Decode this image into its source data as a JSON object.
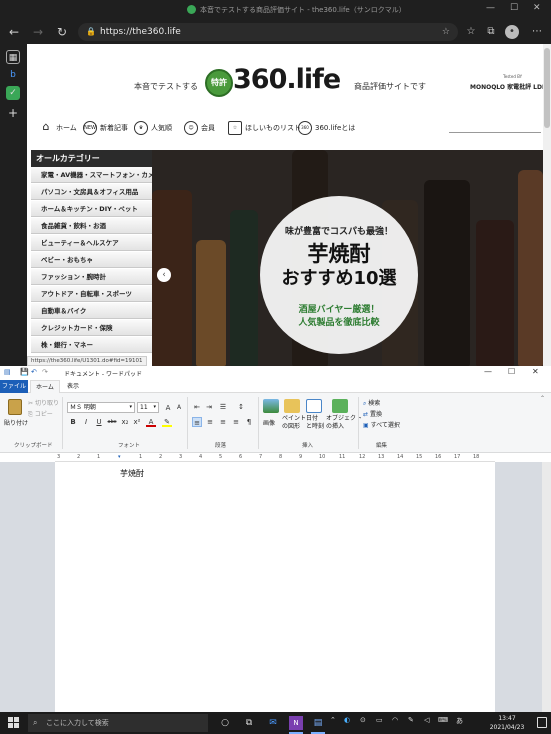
{
  "browser": {
    "window_title": "本音でテストする商品評価サイト - the360.life（サンロクマル）",
    "url": "https://the360.life",
    "status_url": "https://the360.life/U1301.do#fid=19101"
  },
  "site": {
    "tagline_left": "本音でテストする",
    "logo": "360.life",
    "logo_mark": "特許",
    "tagline_right": "商品評価サイトです",
    "tested_by": "Tested BY",
    "media_logos": "MONOQLO  家電批評  LDK",
    "nav": [
      {
        "label": "ホーム",
        "icon": "house"
      },
      {
        "label": "新着記事",
        "icon": "NEW"
      },
      {
        "label": "人気順",
        "icon": "crown"
      },
      {
        "label": "会員",
        "icon": "person"
      },
      {
        "label": "ほしいものリスト",
        "icon": "star"
      },
      {
        "label": "360.lifeとは",
        "icon": "360"
      }
    ],
    "category_header": "オールカテゴリー",
    "categories": [
      "家電・AV機器・スマートフォン・カメラ",
      "パソコン・文房具＆オフィス用品",
      "ホーム＆キッチン・DIY・ペット",
      "食品雑貨・飲料・お酒",
      "ビューティー＆ヘルスケア",
      "ベビー・おもちゃ",
      "ファッション・腕時計",
      "アウトドア・自転車・スポーツ",
      "自動車＆バイク",
      "クレジットカード・保険",
      "株・銀行・マネー"
    ],
    "hero": {
      "subtitle": "味が豊富でコスパも最強！",
      "title_line1": "芋焼酎",
      "title_line2": "おすすめ10選",
      "line3": "酒屋バイヤー厳選！",
      "line4": "人気製品を徹底比較"
    }
  },
  "wordpad": {
    "title": "ドキュメント - ワードパッド",
    "tabs": {
      "file": "ファイル",
      "home": "ホーム",
      "view": "表示"
    },
    "clipboard": {
      "paste": "貼り付け",
      "cut": "切り取り",
      "copy": "コピー",
      "group": "クリップボード"
    },
    "font": {
      "name": "ＭＳ 明朝",
      "size": "11",
      "group": "フォント"
    },
    "paragraph": {
      "group": "段落"
    },
    "insert": {
      "picture": "画像",
      "paint": "ペイント\nの図形",
      "datetime": "日付\nと時刻",
      "object": "オブジェクト\nの挿入",
      "group": "挿入"
    },
    "edit": {
      "find": "検索",
      "replace": "置換",
      "select_all": "すべて選択",
      "group": "編集"
    },
    "document_text": "芋焼酎",
    "ruler": [
      "3",
      "2",
      "1",
      "1",
      "2",
      "3",
      "4",
      "5",
      "6",
      "7",
      "8",
      "9",
      "10",
      "11",
      "12",
      "13",
      "14",
      "15",
      "16",
      "17",
      "18"
    ]
  },
  "taskbar": {
    "search_placeholder": "ここに入力して検索",
    "time": "13:47",
    "date": "2021/04/23",
    "ime": "あ"
  }
}
